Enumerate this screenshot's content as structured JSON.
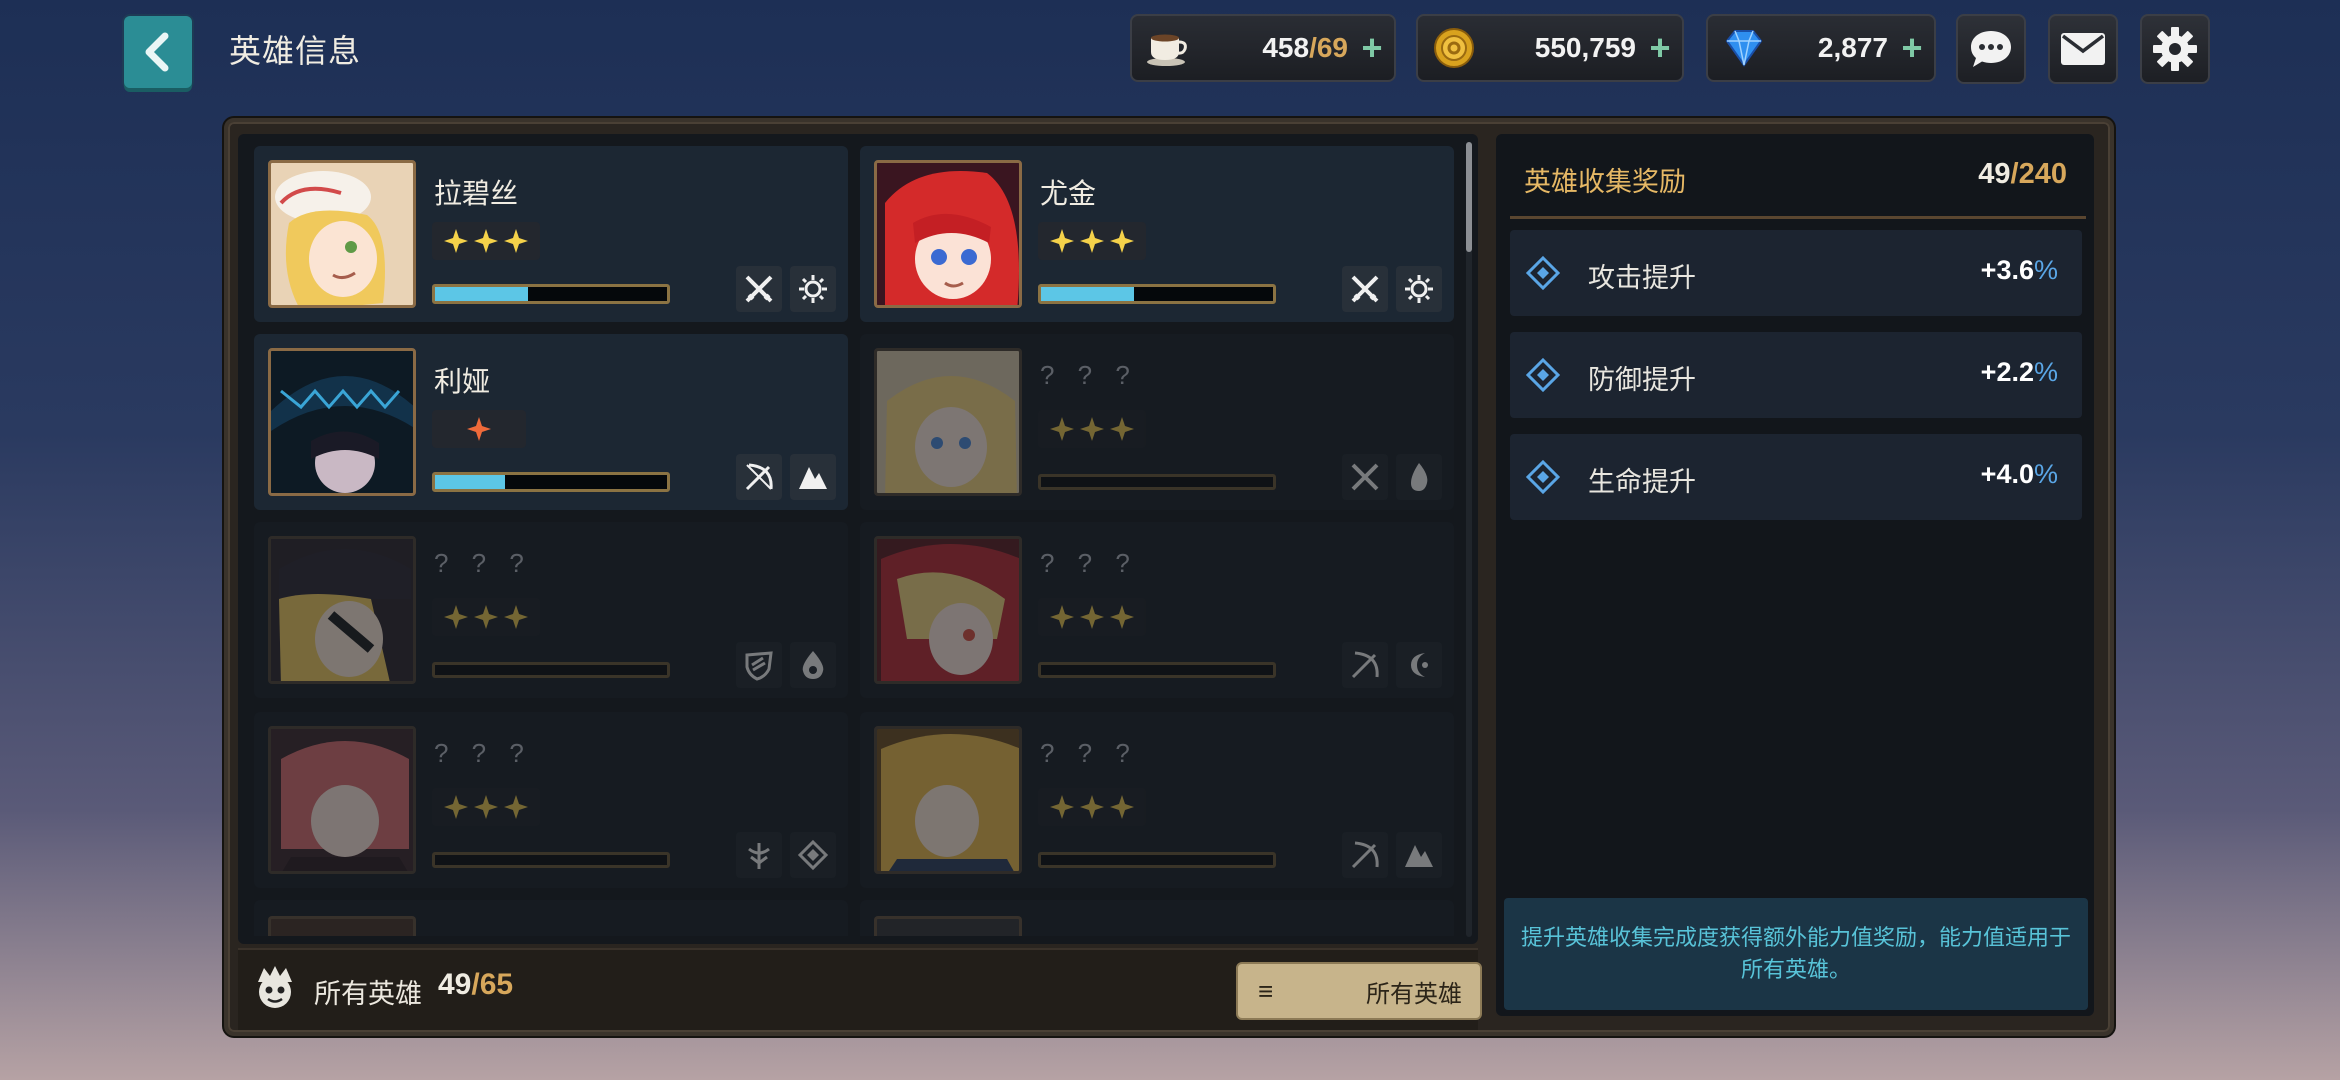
{
  "header": {
    "title": "英雄信息",
    "stamina": {
      "value": "458",
      "cap": "/69"
    },
    "gold": {
      "value": "550,759"
    },
    "gems": {
      "value": "2,877"
    },
    "plus": "+"
  },
  "heroes": [
    {
      "name": "拉碧丝",
      "stars": 3,
      "exp": 0.4,
      "unlocked": true,
      "class_icons": [
        "crossed-swords-icon",
        "sun-gear-icon"
      ]
    },
    {
      "name": "尤金",
      "stars": 3,
      "exp": 0.4,
      "unlocked": true,
      "class_icons": [
        "crossed-swords-icon",
        "sun-gear-icon"
      ]
    },
    {
      "name": "利娅",
      "stars": 1,
      "exp": 0.3,
      "unlocked": true,
      "class_icons": [
        "bow-icon",
        "mountain-icon"
      ]
    },
    {
      "name": "? ? ?",
      "stars": 3,
      "unlocked": false,
      "class_icons": [
        "crossed-swords-icon",
        "flame-icon"
      ]
    },
    {
      "name": "? ? ?",
      "stars": 3,
      "unlocked": false,
      "class_icons": [
        "shield-icon",
        "water-drop-icon"
      ]
    },
    {
      "name": "? ? ?",
      "stars": 3,
      "unlocked": false,
      "class_icons": [
        "bow-icon",
        "moon-icon"
      ]
    },
    {
      "name": "? ? ?",
      "stars": 3,
      "unlocked": false,
      "class_icons": [
        "staff-icon",
        "diamond-icon"
      ]
    },
    {
      "name": "? ? ?",
      "stars": 3,
      "unlocked": false,
      "class_icons": [
        "bow-icon",
        "mountain-icon"
      ]
    }
  ],
  "footer": {
    "label": "所有英雄",
    "count": "49",
    "cap": "/65",
    "filter_icon": "≡",
    "filter_label": "所有英雄"
  },
  "collection": {
    "title": "英雄收集奖励",
    "count": "49",
    "cap": "/240",
    "bonuses": [
      {
        "label": "攻击提升",
        "value": "+3.6",
        "pct": "%"
      },
      {
        "label": "防御提升",
        "value": "+2.2",
        "pct": "%"
      },
      {
        "label": "生命提升",
        "value": "+4.0",
        "pct": "%"
      }
    ],
    "note": "提升英雄收集完成度获得额外能力值奖励，能力值适用于所有英雄。"
  },
  "colors": {
    "accent_teal": "#2b8d95",
    "gold_text": "#d7a75b",
    "exp_fill": "#5cc6e6",
    "percent_blue": "#5aa6e6"
  }
}
